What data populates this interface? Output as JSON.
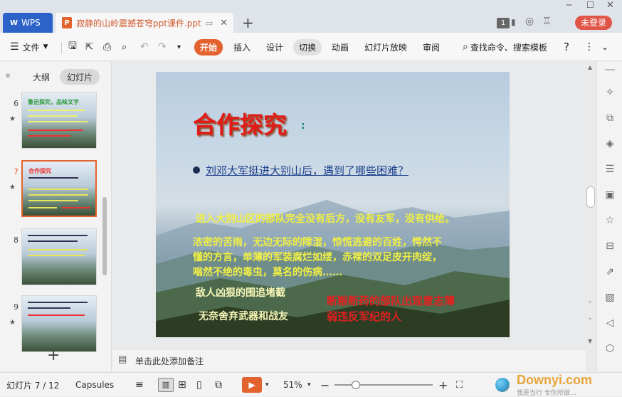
{
  "titlebar": {
    "app_tab": "WPS",
    "doc_tab": "寂静的山岭震撼苍穹ppt课件.ppt",
    "doc_icon": "P",
    "badge_count": "1",
    "login_button": "未登录",
    "new_tab": "+"
  },
  "ribbon": {
    "file_menu": "文件",
    "tabs": [
      "开始",
      "插入",
      "设计",
      "切换",
      "动画",
      "幻灯片放映",
      "审阅"
    ],
    "active_tab": "开始",
    "search_placeholder": "查找命令、搜索模板",
    "accent_color": "#e4622d"
  },
  "left_panel": {
    "tab_outline": "大纲",
    "tab_slides": "幻灯片",
    "thumbnails": [
      {
        "num": "6",
        "title": "鲁迅探究，品味文字",
        "active": false
      },
      {
        "num": "7",
        "title": "合作探究",
        "active": true
      },
      {
        "num": "8",
        "title": "",
        "active": false
      },
      {
        "num": "9",
        "title": "",
        "active": false
      }
    ],
    "add_slide": "+"
  },
  "slide": {
    "title": "合作探究",
    "title_colon": ":",
    "question": "刘邓大军挺进大别山后，遇到了哪些困难？",
    "line1": "进入大别山区的部队完全没有后方，没有友军，没有供给。",
    "line2a": "浓密的苦雨，无边无际的障湿，惊慌逃避的百姓，愕然不",
    "line2b": "懂的方言，单薄的军装腐烂如缕，赤裸的双足皮开肉绽，",
    "line2c": "嗡然不绝的毒虫，莫名的伤病……",
    "line3": "敌人凶狠的围追堵截",
    "line4": "无奈舍弃武器和战友",
    "red1": "断粮断药的部队出现意志薄",
    "red2": "弱违反军纪的人"
  },
  "notes": {
    "placeholder": "单击此处添加备注"
  },
  "status": {
    "slide_counter": "幻灯片 7 / 12",
    "theme": "Capsules",
    "zoom": "51%",
    "watermark": "Downyi.com",
    "watermark_sub": "我是当行  专你所做…"
  }
}
